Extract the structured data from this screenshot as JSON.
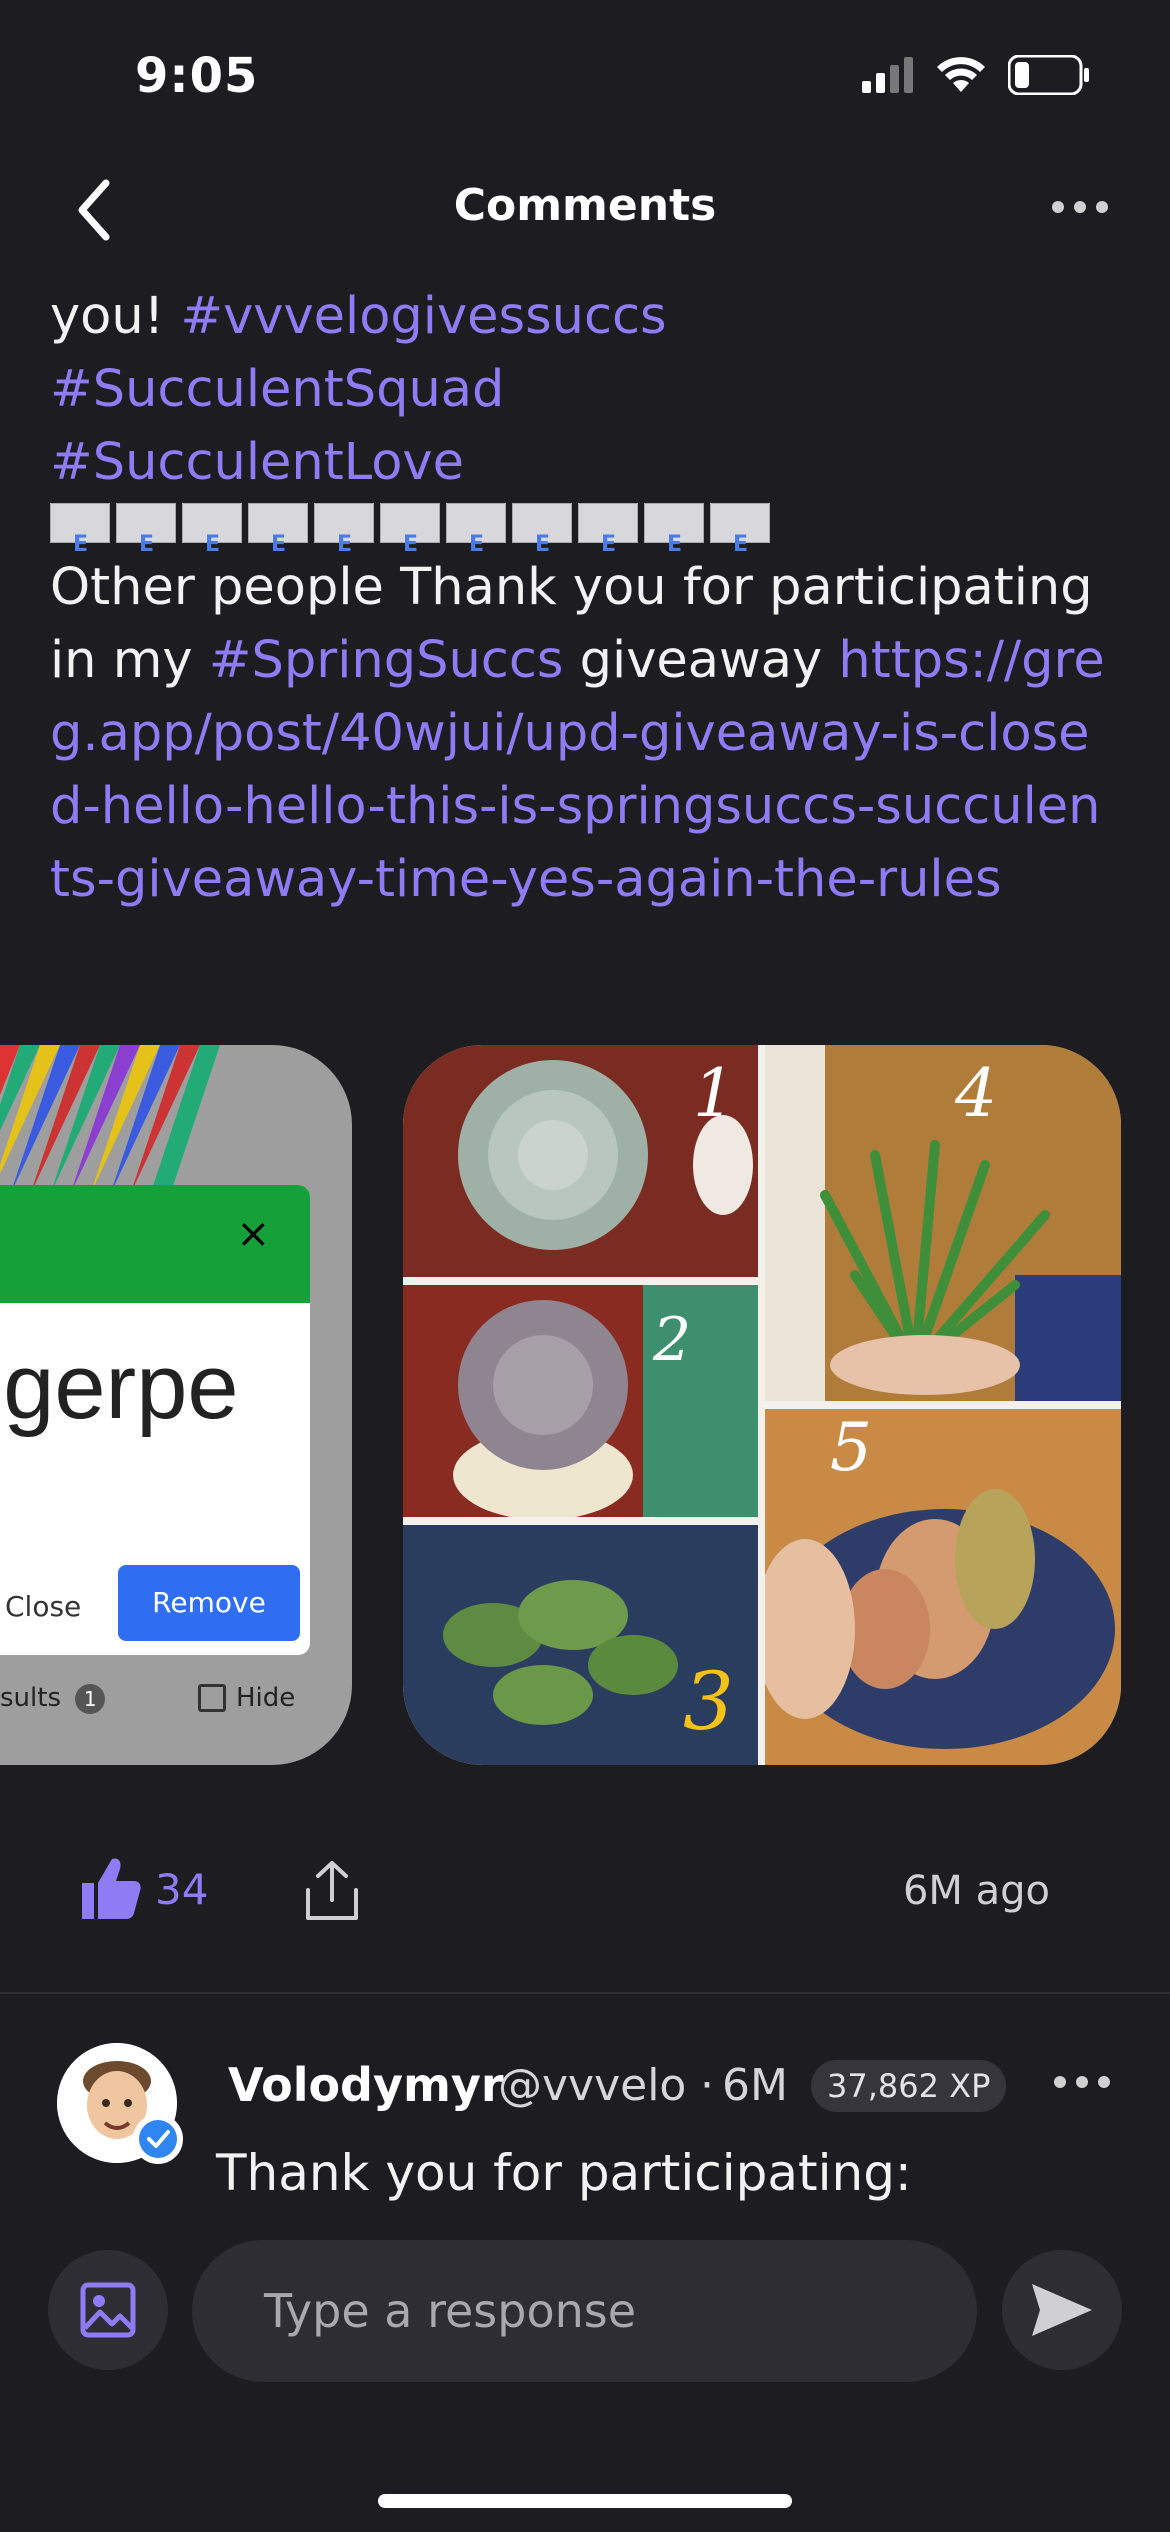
{
  "status_bar": {
    "time": "9:05"
  },
  "header": {
    "title": "Comments"
  },
  "post": {
    "line1_prefix": "you! ",
    "tag1": "#vvvelogivessuccs",
    "tag2": "#SucculentSquad",
    "tag3": "#SucculentLove",
    "envelope_count": 11,
    "body_prefix": "Other people Thank you for  participating in my ",
    "tag4": "#SpringSuccs",
    "body_mid": " giveaway ",
    "link": "https://greg.app/post/40wjui/upd-giveaway-is-closed-hello-hello-this-is-springsuccs-succulents-giveaway-time-yes-again-the-rules"
  },
  "left_image": {
    "dialog_title_fragment": "!",
    "dialog_close_x": "×",
    "dialog_name": "Tigerpe",
    "close_label": "Close",
    "remove_label": "Remove",
    "results_label": "sults",
    "results_count": "1",
    "hide_label": "Hide"
  },
  "right_image": {
    "labels": [
      "1",
      "2",
      "3",
      "4",
      "5"
    ]
  },
  "actions": {
    "likes": "34",
    "time_ago": "6M ago"
  },
  "comment": {
    "name": "Volodymyr",
    "handle": "@vvvelo",
    "dot": "·",
    "age": "6M",
    "xp": "37,862 XP",
    "text": "Thank you for participating:"
  },
  "composer": {
    "placeholder": "Type a response"
  },
  "colors": {
    "accent": "#8f7cf5",
    "background": "#1d1c20",
    "remove_button": "#2f6ef0",
    "dialog_header": "#15a03a"
  }
}
